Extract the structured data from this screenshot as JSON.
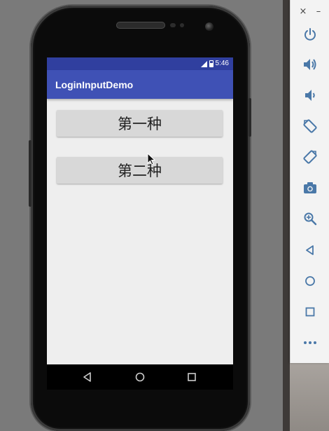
{
  "status_bar": {
    "time": "5:46"
  },
  "app_bar": {
    "title": "LoginInputDemo"
  },
  "buttons": {
    "first": "第一种",
    "second": "第二种"
  },
  "emulator_toolbar": {
    "close": "×",
    "minimize": "–",
    "items": [
      "power-icon",
      "volume-up-icon",
      "volume-down-icon",
      "rotate-left-icon",
      "rotate-right-icon",
      "camera-icon",
      "zoom-icon",
      "back-icon",
      "home-icon",
      "overview-icon",
      "more-icon"
    ]
  },
  "colors": {
    "status_bar": "#303f9f",
    "app_bar": "#3f51b5",
    "screen_bg": "#eeeeee",
    "button": "#d8d8d8",
    "toolbar_icon": "#4a78a8"
  }
}
